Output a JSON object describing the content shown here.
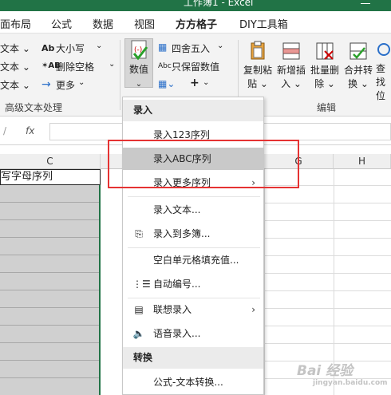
{
  "titlebar": {
    "title": "工作簿1 - Excel"
  },
  "tabs": [
    "面布局",
    "公式",
    "数据",
    "视图",
    "方方格子",
    "DIY工具箱"
  ],
  "ribbon": {
    "left_col": [
      "文本 ⌄",
      "文本 ⌄",
      "文本 ⌄"
    ],
    "case_upper": "大小写",
    "remove_space": "删除空格",
    "more": "更多",
    "value_btn": "数值",
    "round": "四舍五入",
    "keep_numeric": "只保留数值",
    "group_label_text": "高级文本处理",
    "group_label_edit": "编辑",
    "edit_btns": [
      {
        "top": "复制粘",
        "bottom": "贴 ⌄"
      },
      {
        "top": "新增插",
        "bottom": "入 ⌄"
      },
      {
        "top": "批量删",
        "bottom": "除 ⌄"
      },
      {
        "top": "合并转",
        "bottom": "换 ⌄"
      },
      {
        "top": "查找",
        "bottom": "位"
      }
    ]
  },
  "formula": {
    "fx": "fx"
  },
  "sheet": {
    "col_c": "C",
    "col_g": "G",
    "col_h": "H",
    "cell_c1": "写字母序列"
  },
  "menu": {
    "header_input": "录入",
    "items_top": [
      {
        "label": "录入123序列"
      },
      {
        "label": "录入ABC序列"
      },
      {
        "label": "录入更多序列",
        "arrow": "›"
      }
    ],
    "items_mid": [
      {
        "label": "录入文本..."
      },
      {
        "label": "录入到多簿..."
      }
    ],
    "items_mid2": [
      {
        "label": "空白单元格填充值..."
      },
      {
        "label": "自动编号..."
      }
    ],
    "items_mid3": [
      {
        "label": "联想录入",
        "arrow": "›"
      },
      {
        "label": "语音录入..."
      }
    ],
    "header_convert": "转换",
    "convert_item": "公式-文本转换..."
  },
  "watermark": {
    "main": "Bai 经验",
    "sub": "jingyan.baidu.com"
  },
  "colors": {
    "excel_green": "#217346",
    "highlight_red": "#e53333"
  }
}
